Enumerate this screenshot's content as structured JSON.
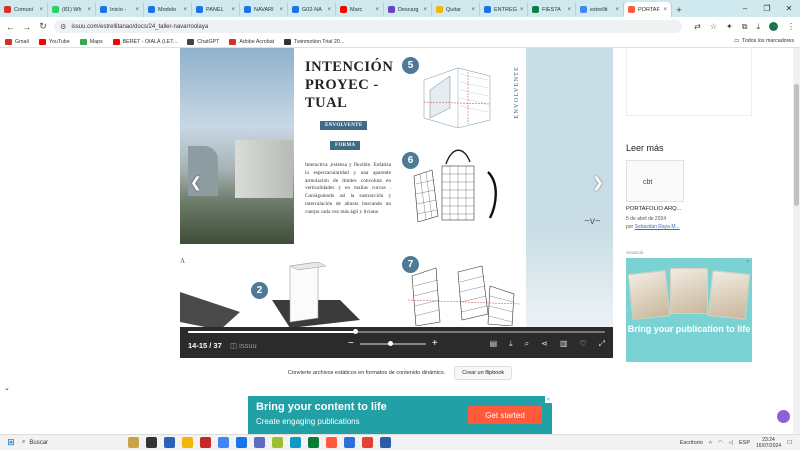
{
  "browser": {
    "tabs": [
      {
        "label": "Comuni",
        "color": "#d93025"
      },
      {
        "label": "(81) Wh",
        "color": "#25d366"
      },
      {
        "label": "Inicio -",
        "color": "#1a73e8"
      },
      {
        "label": "Modelo",
        "color": "#1a73e8"
      },
      {
        "label": "PANEL",
        "color": "#1a73e8"
      },
      {
        "label": "NAVARI",
        "color": "#1a73e8"
      },
      {
        "label": "G02-NA",
        "color": "#1a73e8"
      },
      {
        "label": "Marc",
        "color": "#ff0000"
      },
      {
        "label": "Descarg",
        "color": "#6f42c1"
      },
      {
        "label": "Quitar",
        "color": "#f2b705"
      },
      {
        "label": "ENTREG",
        "color": "#1a73e8"
      },
      {
        "label": "FIESTA",
        "color": "#0b8043"
      },
      {
        "label": "estrellit",
        "color": "#4285f4"
      },
      {
        "label": "PORTAF",
        "color": "#ff5a3c",
        "active": true
      }
    ],
    "new_tab": "+",
    "url": "issuu.com/estrellitanao/docs/24_taller-navarroolaya",
    "bookmarks": [
      {
        "label": "Gmail",
        "color": "#d93025"
      },
      {
        "label": "YouTube",
        "color": "#ff0000"
      },
      {
        "label": "Maps",
        "color": "#34a853"
      },
      {
        "label": "BERET - OIALÁ (LET...",
        "color": "#ff0000"
      },
      {
        "label": "ChatGPT",
        "color": "#444444"
      },
      {
        "label": "Adobe Acrobat",
        "color": "#d93025"
      },
      {
        "label": "Twinmotion Trial 20...",
        "color": "#333333"
      }
    ],
    "bookmarks_all": "Todos los marcadores",
    "profile_initial": "C"
  },
  "publication": {
    "title_line1": "INTENCIÓN",
    "title_line2": "PROYEC -",
    "title_line3": "TUAL",
    "pill_envolvente": "ENVOLVENTE",
    "pill_forma": "FORMA",
    "body_text": "Interactiva ,extensa y flexible. Enfatiza la espectacularidad y una aparente armolación de límites convoluta en verticalidades y en mallas curvas . Consiguiendo así la sustracción y intercalación de alturas buscando un cuerpo cada vez más ágil y liviano",
    "vertical_label": "ENVOLVENTE",
    "bubbles": [
      "5",
      "6",
      "7",
      "2"
    ],
    "lower_letter": "A"
  },
  "viewer_controls": {
    "pages": "14-15 / 37",
    "brand": "issuu",
    "zoom_out": "−",
    "zoom_in": "+",
    "progress": 0.4,
    "zoom_level": 0.45
  },
  "convert": {
    "text": "Convierte archivos estáticos en formatos de contenido dinámico.",
    "button": "Crear un flipbook"
  },
  "sidebar": {
    "heading": "Leer más",
    "card_thumb": "cbt",
    "card_title": "PORTAFOLIO ARQ...",
    "card_date": "5 de abril de 2024",
    "card_by_prefix": "por",
    "card_author": "Sebastián Raya M...",
    "ad_label": "Anuncio",
    "ad_text": "Bring your publication to life",
    "ad_close": "×"
  },
  "bottom_ad": {
    "headline": "Bring your content to life",
    "subline": "Create engaging publications",
    "button": "Get started",
    "close": "×"
  },
  "taskbar": {
    "search": "Buscar",
    "desktop_label": "Escritorio",
    "lang": "ESP",
    "time": "23:24",
    "date": "16/07/2024"
  }
}
